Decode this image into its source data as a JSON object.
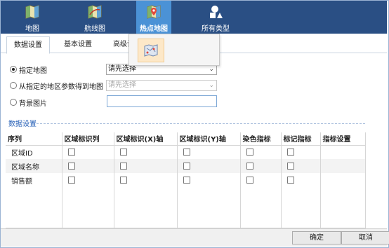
{
  "ribbon": {
    "buttons": [
      {
        "label": "地图",
        "icon": "map-icon",
        "active": false
      },
      {
        "label": "航线图",
        "icon": "route-map-icon",
        "active": false
      },
      {
        "label": "热点地图",
        "icon": "hotspot-map-icon",
        "active": true
      },
      {
        "label": "所有类型",
        "icon": "all-types-icon",
        "active": false
      }
    ],
    "bg_color": "#2a4f84",
    "active_color": "#4b92d6"
  },
  "tabs": [
    {
      "label": "数据设置",
      "active": true
    },
    {
      "label": "基本设置",
      "active": false
    },
    {
      "label": "高级设",
      "active": false
    }
  ],
  "form": {
    "option1_label": "指定地图",
    "option1_select": "请先选择",
    "option2_label": "从指定的地区参数得到地图",
    "option2_select": "请先选择",
    "option3_label": "背景图片",
    "option3_value": ""
  },
  "section": {
    "title": "数据设置"
  },
  "grid": {
    "columns": [
      "序列",
      "区域标识列",
      "区域标识(X)轴",
      "区域标识(Y)轴",
      "染色指标",
      "标记指标",
      "指标设置"
    ],
    "rows": [
      {
        "name": "区域ID"
      },
      {
        "name": "区域名称"
      },
      {
        "name": "销售额"
      }
    ]
  },
  "footer": {
    "ok": "确定",
    "cancel": "取消"
  }
}
